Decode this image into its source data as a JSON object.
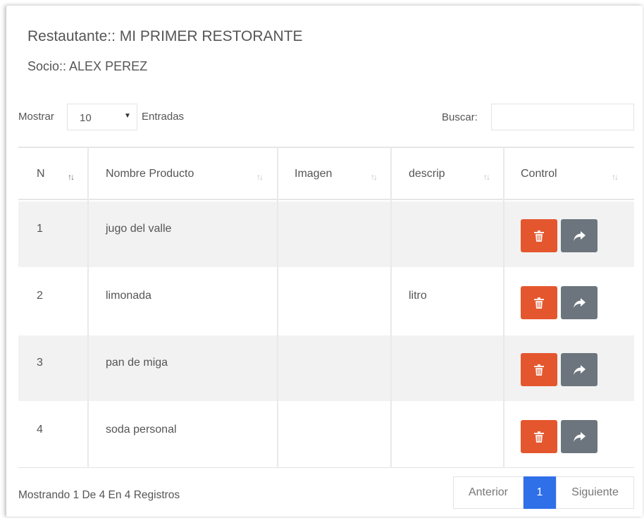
{
  "header": {
    "restaurant": "Restautante:: MI PRIMER RESTORANTE",
    "partner": "Socio:: ALEX PEREZ"
  },
  "controls": {
    "show_label": "Mostrar",
    "page_length": "10",
    "entries_label": "Entradas",
    "search_label": "Buscar:",
    "search_value": ""
  },
  "table": {
    "columns": [
      "N",
      "Nombre Producto",
      "Imagen",
      "descrip",
      "Control"
    ],
    "rows": [
      {
        "n": "1",
        "name": "jugo del valle",
        "image": "",
        "descrip": ""
      },
      {
        "n": "2",
        "name": "limonada",
        "image": "",
        "descrip": "litro"
      },
      {
        "n": "3",
        "name": "pan de miga",
        "image": "",
        "descrip": ""
      },
      {
        "n": "4",
        "name": "soda personal",
        "image": "",
        "descrip": ""
      }
    ],
    "row_actions": [
      "trash-icon",
      "share-arrow-icon"
    ]
  },
  "footer": {
    "info": "Mostrando 1 De 4 En 4 Registros",
    "prev": "Anterior",
    "page": "1",
    "next": "Siguiente"
  },
  "colors": {
    "delete_button": "#e4572e",
    "forward_button": "#6c757d",
    "active_page": "#2f6fe8",
    "striped_row": "#f2f2f2"
  }
}
